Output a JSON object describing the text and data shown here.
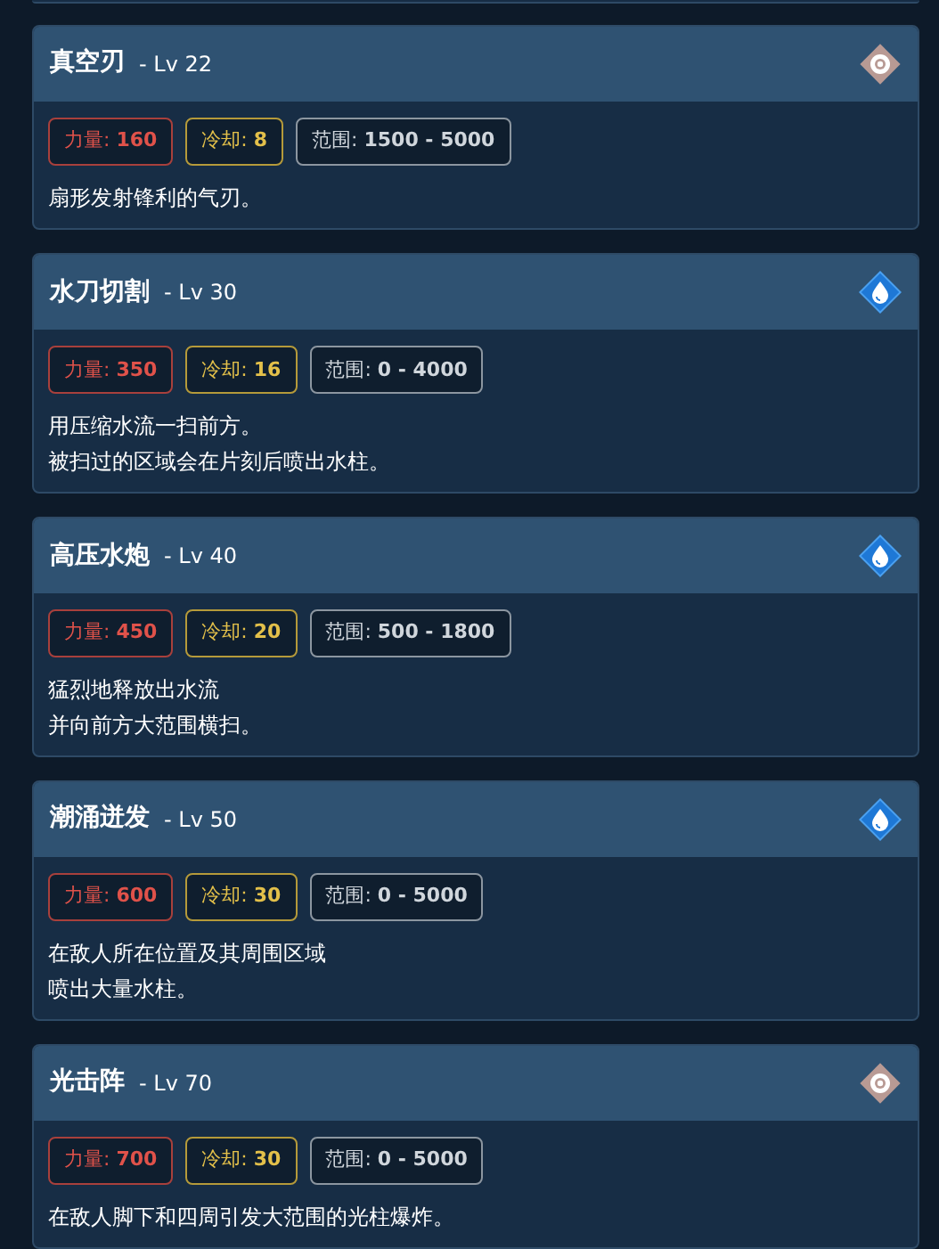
{
  "skills": [
    {
      "name": "真空刃",
      "level": "- Lv 22",
      "element": {
        "kind": "neutral"
      },
      "stats": [
        {
          "kind": "power",
          "text": "力量: **160**"
        },
        {
          "kind": "cooldown",
          "text": "冷却: **8**"
        },
        {
          "kind": "range",
          "text": "范围: **1500 - 5000**"
        }
      ],
      "description": [
        "扇形发射锋利的气刃。"
      ]
    },
    {
      "name": "水刀切割",
      "level": "- Lv 30",
      "element": {
        "kind": "water"
      },
      "stats": [
        {
          "kind": "power",
          "text": "力量: **350**"
        },
        {
          "kind": "cooldown",
          "text": "冷却: **16**"
        },
        {
          "kind": "range",
          "text": "范围: **0 - 4000**"
        }
      ],
      "description": [
        "用压缩水流一扫前方。",
        "被扫过的区域会在片刻后喷出水柱。"
      ]
    },
    {
      "name": "高压水炮",
      "level": "- Lv 40",
      "element": {
        "kind": "water"
      },
      "stats": [
        {
          "kind": "power",
          "text": "力量: **450**"
        },
        {
          "kind": "cooldown",
          "text": "冷却: **20**"
        },
        {
          "kind": "range",
          "text": "范围: **500 - 1800**"
        }
      ],
      "description": [
        "猛烈地释放出水流",
        "并向前方大范围横扫。"
      ]
    },
    {
      "name": "潮涌迸发",
      "level": "- Lv 50",
      "element": {
        "kind": "water"
      },
      "stats": [
        {
          "kind": "power",
          "text": "力量: **600**"
        },
        {
          "kind": "cooldown",
          "text": "冷却: **30**"
        },
        {
          "kind": "range",
          "text": "范围: **0 - 5000**"
        }
      ],
      "description": [
        "在敌人所在位置及其周围区域",
        "喷出大量水柱。"
      ]
    },
    {
      "name": "光击阵",
      "level": "- Lv 70",
      "element": {
        "kind": "neutral"
      },
      "stats": [
        {
          "kind": "power",
          "text": "力量: **700**"
        },
        {
          "kind": "cooldown",
          "text": "冷却: **30**"
        },
        {
          "kind": "range",
          "text": "范围: **0 - 5000**"
        }
      ],
      "description": [
        "在敌人脚下和四周引发大范围的光柱爆炸。"
      ]
    }
  ]
}
